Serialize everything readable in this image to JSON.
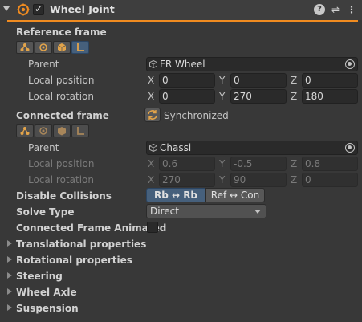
{
  "header": {
    "title": "Wheel Joint",
    "enabled": true,
    "icons": [
      "help-icon",
      "presets-icon",
      "kebab-menu-icon"
    ]
  },
  "reference_frame": {
    "label": "Reference frame",
    "tools": [
      "bone-icon",
      "target-center-icon",
      "box-icon",
      "axis-icon"
    ],
    "parent_label": "Parent",
    "parent_value": "FR Wheel",
    "local_position_label": "Local position",
    "local_position": {
      "x": "0",
      "y": "0",
      "z": "0"
    },
    "local_rotation_label": "Local rotation",
    "local_rotation": {
      "x": "0",
      "y": "270",
      "z": "180"
    }
  },
  "connected_frame": {
    "label": "Connected frame",
    "sync_label": "Synchronized",
    "parent_label": "Parent",
    "parent_value": "Chassi",
    "local_position_label": "Local position",
    "local_position": {
      "x": "0.6",
      "y": "-0.5",
      "z": "0.8"
    },
    "local_rotation_label": "Local rotation",
    "local_rotation": {
      "x": "270",
      "y": "90",
      "z": "0"
    }
  },
  "axis_labels": {
    "x": "X",
    "y": "Y",
    "z": "Z"
  },
  "disable_collisions": {
    "label": "Disable Collisions",
    "options": [
      "Rb ↔ Rb",
      "Ref ↔ Con"
    ],
    "selected": "Rb ↔ Rb"
  },
  "solve_type": {
    "label": "Solve Type",
    "value": "Direct"
  },
  "connected_frame_animated": {
    "label": "Connected Frame Animated",
    "checked": false
  },
  "sections": [
    "Translational properties",
    "Rotational properties",
    "Steering",
    "Wheel Axle",
    "Suspension"
  ],
  "colors": {
    "accent": "#f08b20",
    "selected": "#46607c",
    "background": "#383838"
  }
}
